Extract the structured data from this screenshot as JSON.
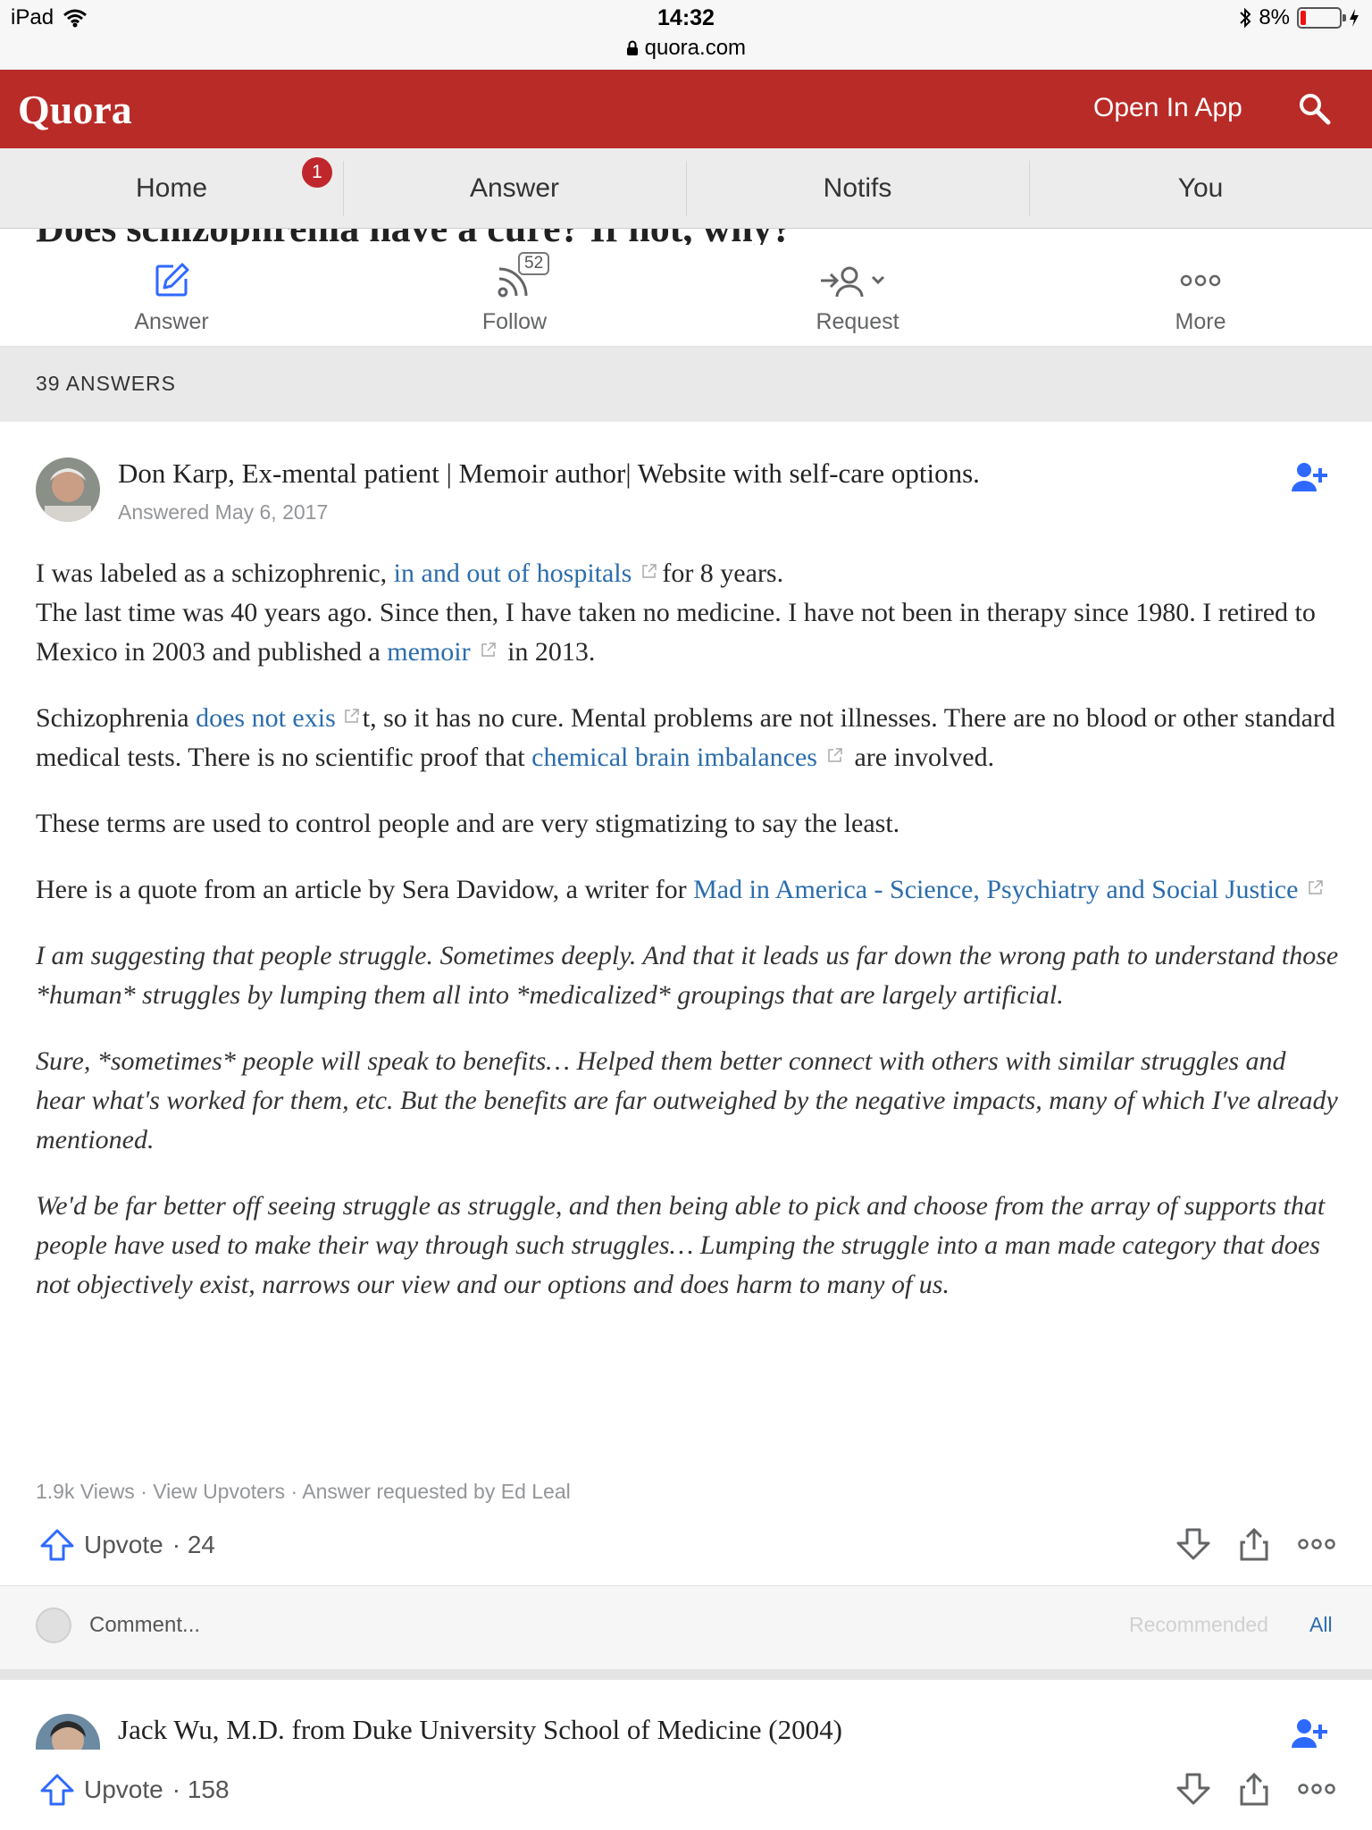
{
  "status_bar": {
    "device": "iPad",
    "time": "14:32",
    "url": "quora.com",
    "battery": "8%"
  },
  "header": {
    "logo": "Quora",
    "open_in_app": "Open In App"
  },
  "nav": {
    "tabs": [
      {
        "label": "Home"
      },
      {
        "label": "Answer"
      },
      {
        "label": "Notifs"
      },
      {
        "label": "You"
      }
    ],
    "home_badge": "1"
  },
  "question": {
    "title": "Does schizophrenia have a cure? If not, why?"
  },
  "actions": {
    "answer": "Answer",
    "follow": "Follow",
    "follow_count": "52",
    "request": "Request",
    "more": "More"
  },
  "answers_count": "39 ANSWERS",
  "answer1": {
    "author": "Don Karp, Ex-mental patient | Memoir author| Website with self-care options.",
    "answered": "Answered May 6, 2017",
    "p1": {
      "t1": "I was labeled as a schizophrenic, ",
      "link1": "in and out of hospitals",
      "t2": "for 8 years.",
      "t3": "The last time was 40 years ago. Since then, I have taken no medicine. I have not been in therapy since 1980. I retired to Mexico in 2003 and published a ",
      "link2": "memoir",
      "t4": " in 2013."
    },
    "p2": {
      "t1": "Schizophrenia ",
      "link1": "does not exis",
      "t2": "t, so it has no cure. Mental problems are not illnesses. There are no blood or other standard medical tests. There is no scientific proof that ",
      "link2": "chemical brain imbalances",
      "t3": " are involved."
    },
    "p3": "These terms are used to control people and are very stigmatizing to say the least.",
    "p4": {
      "t1": "Here is a quote from an article by Sera Davidow, a writer for ",
      "link1": "Mad in America - Science, Psychiatry and Social Justice"
    },
    "q1": "I am suggesting that people struggle. Sometimes deeply. And that it leads us far down the wrong path to understand those *human* struggles by lumping them all into *medicalized* groupings that are largely artificial.",
    "q2": "Sure, *sometimes* people will speak to benefits… Helped them better connect with others with similar struggles and hear what's worked for them, etc. But the benefits are far outweighed by the negative impacts, many of which I've already mentioned.",
    "q3": "We'd be far better off seeing struggle as struggle, and then being able to pick and choose from the array of supports that people have used to make their way through such struggles… Lumping the struggle into a man made category that does not objectively exist, narrows our view and our options and does harm to many of us.",
    "meta": "1.9k Views · View Upvoters · Answer requested by Ed Leal",
    "upvote_label": "Upvote",
    "upvote_count": "· 24"
  },
  "comments": {
    "placeholder": "Comment...",
    "recommended": "Recommended",
    "all": "All"
  },
  "answer2": {
    "author": "Jack Wu, M.D. from Duke University School of Medicine (2004)",
    "upvote_label": "Upvote",
    "upvote_count": "· 158"
  },
  "colors": {
    "brand_red": "#b92b27",
    "link_blue": "#2b6dad",
    "badge_red": "#c0272d"
  }
}
